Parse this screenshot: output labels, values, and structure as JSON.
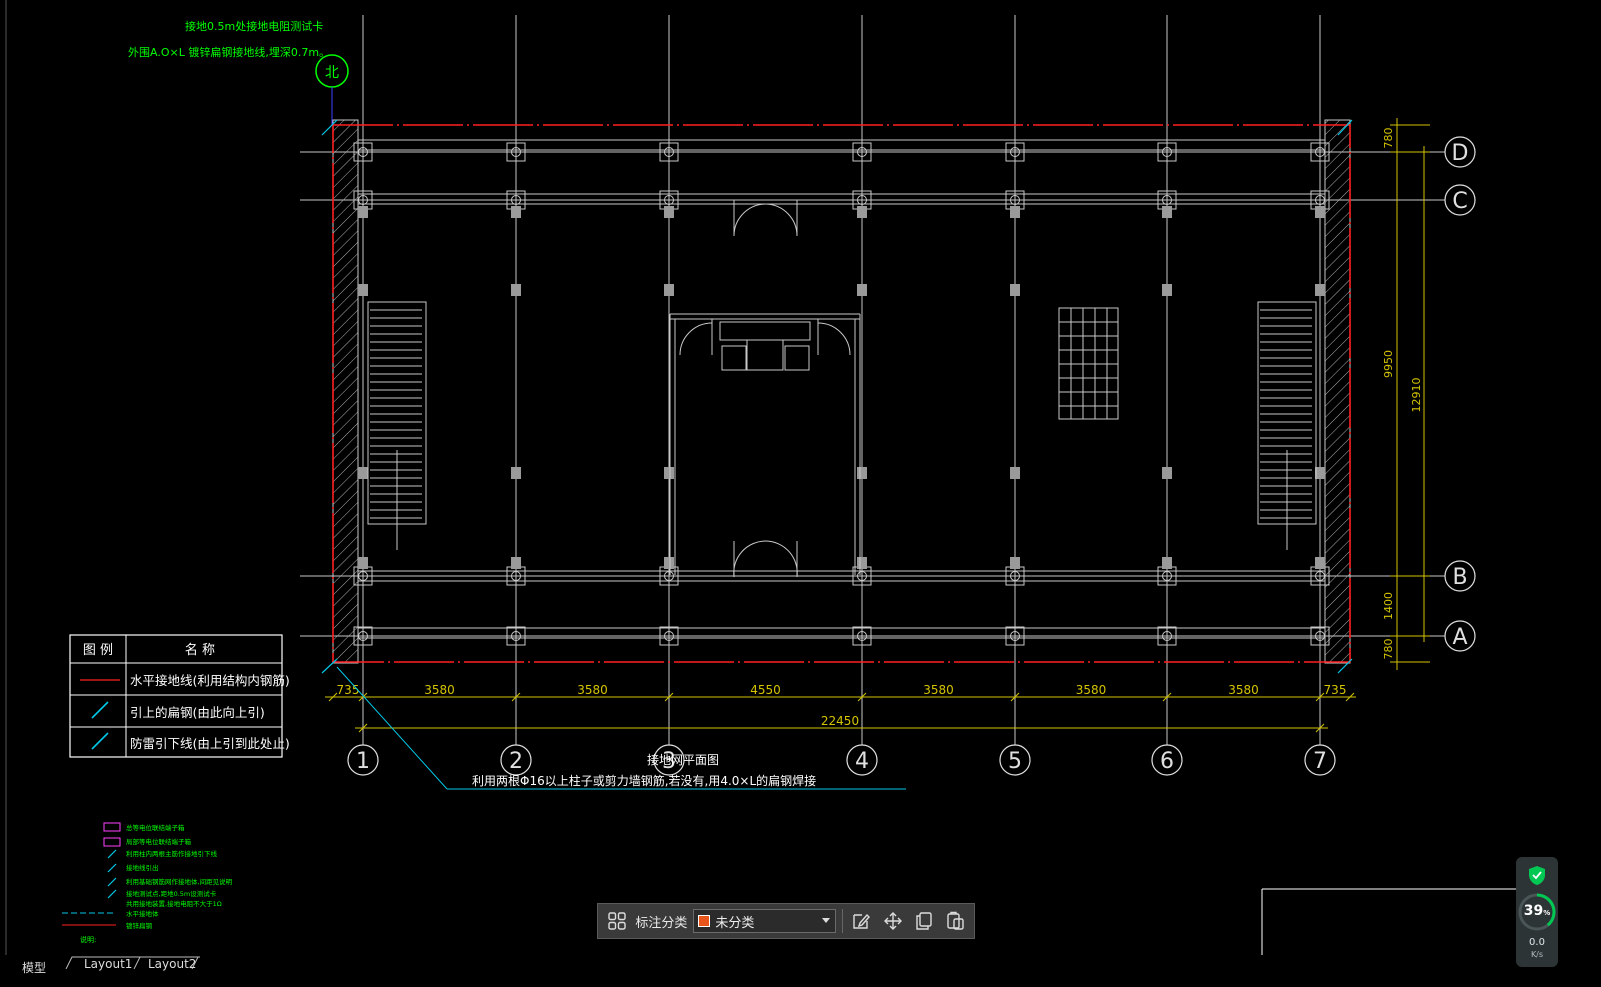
{
  "notes": {
    "line1": "接地0.5m处接地电阻测试卡",
    "line2": "外围A.O×L 镀锌扁钢接地线,埋深0.7m。"
  },
  "compass_glyph": "北",
  "grid_rows": [
    "D",
    "C",
    "B",
    "A"
  ],
  "grid_cols": [
    "1",
    "2",
    "3",
    "4",
    "5",
    "6",
    "7"
  ],
  "dims_bottom": [
    "735",
    "3580",
    "3580",
    "4550",
    "3580",
    "3580",
    "3580",
    "735"
  ],
  "dim_total": "22450",
  "dims_right": [
    "780",
    "9950",
    "1400",
    "780"
  ],
  "dim_right_total": "12910",
  "plan_title": "接地网平面图",
  "plan_note": "利用两根Φ16以上柱子或剪力墙钢筋,若没有,用4.0×L的扁钢焊接",
  "legend": {
    "col1": "图 例",
    "col2": "名   称",
    "rows": [
      "水平接地线(利用结构内钢筋)",
      "引上的扁钢(由此向上引)",
      "防雷引下线(由上引到此处止)"
    ]
  },
  "small_legend": [
    "总等电位联结端子箱",
    "局部等电位联结端子箱",
    "利用柱内两根主筋作接地引下线",
    "接地线引出",
    "利用基础钢筋网作接地体,间距见说明",
    "接地测试点,距地0.5m设测试卡",
    "共用接地装置,接地电阻不大于1Ω",
    "水平接地体",
    "镀锌扁钢"
  ],
  "small_legend_footer": "说明:",
  "toolbar": {
    "label": "标注分类",
    "selected": "未分类",
    "icons": [
      "grid-icon",
      "edit-icon",
      "move-icon",
      "copy-icon",
      "paste-icon"
    ]
  },
  "tabs": {
    "model": "模型",
    "layout1": "Layout1",
    "layout2": "Layout2"
  },
  "widget": {
    "percent": "39",
    "percent_unit": "%",
    "speed": "0.0",
    "speed_unit": "K/s"
  },
  "colors": {
    "background": "#000000",
    "grid_line": "#c8c8c8",
    "dimension": "#d4c400",
    "ground_line": "#ff2020",
    "annotation_green": "#00ff00",
    "leader_cyan": "#00c8e8",
    "widget_accent": "#00c853"
  }
}
